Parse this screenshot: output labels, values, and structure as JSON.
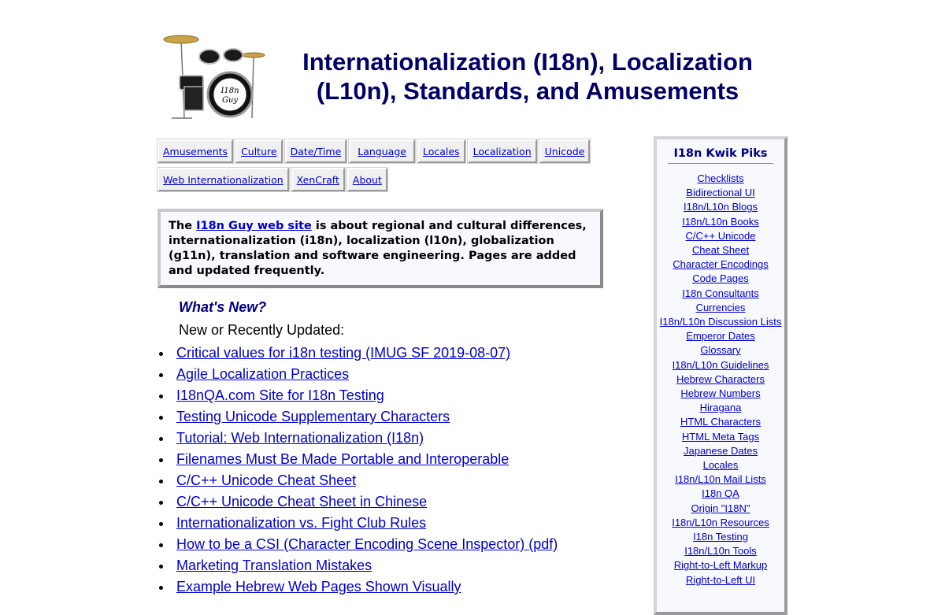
{
  "header": {
    "title": "Internationalization (I18n), Localization (L10n), Standards, and Amusements",
    "logo_text": "I18n Guy"
  },
  "nav": {
    "row1": [
      "Amusements",
      "Culture",
      "Date/Time",
      "Language",
      "Locales",
      "Localization",
      "Unicode"
    ],
    "row2": [
      "Web Internationalization",
      "XenCraft",
      "About"
    ]
  },
  "intro": {
    "prefix": "The ",
    "link": "I18n Guy web site",
    "suffix": " is about regional and cultural differences, internationalization (i18n), localization (l10n), globalization (g11n), translation and software engineering. Pages are added and updated frequently."
  },
  "whats_new": {
    "heading": "What's New?",
    "subheading": "New or Recently Updated:",
    "items": [
      "Critical values for i18n testing (IMUG SF 2019-08-07)",
      "Agile Localization Practices",
      "I18nQA.com Site for I18n Testing",
      "Testing Unicode Supplementary Characters",
      "Tutorial: Web Internationalization (I18n)",
      "Filenames Must Be Made Portable and Interoperable",
      "C/C++ Unicode Cheat Sheet",
      "C/C++ Unicode Cheat Sheet in Chinese",
      "Internationalization vs. Fight Club Rules",
      "How to be a CSI (Character Encoding Scene Inspector) (pdf)",
      "Marketing Translation Mistakes",
      "Example Hebrew Web Pages Shown Visually"
    ]
  },
  "sidebar": {
    "title": "I18n Kwik Piks",
    "links": [
      "Checklists",
      "Bidirectional UI",
      "I18n/L10n Blogs",
      "I18n/L10n Books",
      "C/C++ Unicode Cheat Sheet",
      "Character Encodings",
      "Code Pages",
      "I18n Consultants",
      "Currencies",
      "I18n/L10n Discussion Lists",
      "Emperor Dates",
      "Glossary",
      "I18n/L10n Guidelines",
      "Hebrew Characters",
      "Hebrew Numbers",
      "Hiragana",
      "HTML Characters",
      "HTML Meta Tags",
      "Japanese Dates",
      "Locales",
      "I18n/L10n Mail Lists",
      "I18n QA",
      "Origin \"I18N\"",
      "I18n/L10n Resources",
      "I18n Testing",
      "I18n/L10n Tools",
      "Right-to-Left Markup",
      "Right-to-Left UI"
    ]
  },
  "colors": {
    "title": "#000066",
    "link": "#0000cc",
    "heading": "#000080",
    "panel_bg": "#f8f8ff"
  }
}
